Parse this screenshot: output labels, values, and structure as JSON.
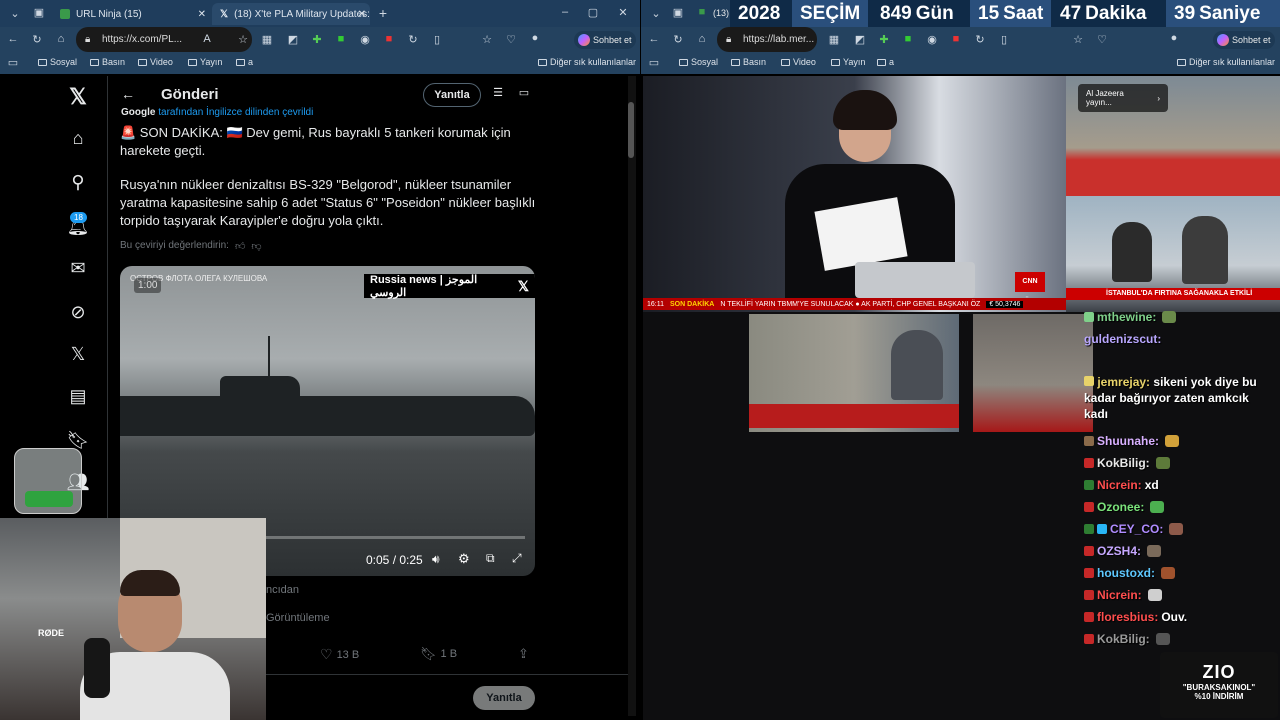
{
  "left_window": {
    "tabs": [
      {
        "title": "URL Ninja (15)"
      },
      {
        "title": "(18) X'te PLA Military Updates: \""
      }
    ],
    "url": "https://x.com/PL...",
    "chat_label": "Sohbet et",
    "bookmarks": [
      "Sosyal",
      "Basın",
      "Video",
      "Yayın",
      "a"
    ],
    "other_bookmarks": "Diğer sık kullanılanlar"
  },
  "right_window": {
    "tab_partial": "(13) I",
    "url": "https://lab.mer...",
    "chat_label": "Sohbet et",
    "bookmarks": [
      "Sosyal",
      "Basın",
      "Video",
      "Yayın",
      "a"
    ],
    "other_bookmarks": "Diğer sık kullanılanlar"
  },
  "countdown": {
    "year": "2028",
    "label": "SEÇİM",
    "days": "849",
    "days_unit": "Gün",
    "hours": "15",
    "hours_unit": "Saat",
    "minutes": "47",
    "minutes_unit": "Dakika",
    "seconds": "39",
    "seconds_unit": "Saniye"
  },
  "x_sidebar": {
    "notification_count": "18"
  },
  "x_post": {
    "header_title": "Gönderi",
    "reply_button": "Yanıtla",
    "translated_note": "tarafından İngilizce dilinden çevrildi",
    "google": "Google",
    "headline": "🚨 SON DAKİKA: 🇷🇺 Dev gemi, Rus bayraklı 5 tankeri korumak için harekete geçti.",
    "body": "Rusya'nın nükleer denizaltısı BS-329 \"Belgorod\", nükleer tsunamiler yaratma kapasitesine sahip 6 adet \"Status 6\" \"Poseidon\" nükleer başlıklı torpido taşıyarak Karayipler'e doğru yola çıktı.",
    "rate_translation": "Bu çeviriyi değerlendirin:",
    "video": {
      "overlay_time": "1:00",
      "watermark": "Russia news | الموجز الروسي",
      "caption_top": "ОСТРОВ ФЛОТА ОЛЕГА КУЛЕШОВА",
      "time": "0:05 / 0:25"
    },
    "from_text": "ncıdan",
    "views_text": "Görüntüleme",
    "likes": "13 B",
    "bookmarks": "1 B",
    "reply_bottom": "Yanıtla"
  },
  "tv": {
    "breaking": "SON DAKİKA",
    "ticker": "N TEKLİFİ YARIN TBMM'YE SUNULACAK   ●   AK PARTİ, CHP GENEL BAŞKANI ÖZ",
    "time": "16:11",
    "market": "€ 50,3746",
    "channel": "CNN TÜRK",
    "aljazeera_label": "Al Jazeera yayın...",
    "side_headline": "İSTANBUL'DA FIRTINA SAĞANAKLA ETKİLİ"
  },
  "chat": [
    {
      "user": "mthewine:",
      "color": "#7fd08a",
      "msg": ""
    },
    {
      "user": "guldenizscut:",
      "color": "#b9a7ff",
      "msg": ""
    },
    {
      "user": "jemrejay:",
      "color": "#e8d36a",
      "msg": "sikeni yok diye bu kadar bağırıyor zaten amkcık kadı"
    },
    {
      "user": "Shuunahe:",
      "color": "#d8b0ff",
      "msg": ""
    },
    {
      "user": "KokBilig:",
      "color": "#e8e8e8",
      "msg": ""
    },
    {
      "user": "Nicrein:",
      "color": "#ff4e4e",
      "msg": "xd"
    },
    {
      "user": "Ozonee:",
      "color": "#7be37b",
      "msg": ""
    },
    {
      "user": "CEY_CO:",
      "color": "#b08cff",
      "msg": ""
    },
    {
      "user": "OZSH4:",
      "color": "#c6a8ff",
      "msg": ""
    },
    {
      "user": "houstoxd:",
      "color": "#5ec8ff",
      "msg": ""
    },
    {
      "user": "Nicrein:",
      "color": "#ff4e4e",
      "msg": ""
    },
    {
      "user": "floresbius:",
      "color": "#ff4e4e",
      "msg": "Ouv."
    },
    {
      "user": "KokBilig:",
      "color": "#9a9a9a",
      "msg": ""
    }
  ],
  "promo": {
    "logo": "ZIO",
    "code": "\"BURAKSAKINOL\"",
    "discount": "%10 İNDİRİM"
  }
}
